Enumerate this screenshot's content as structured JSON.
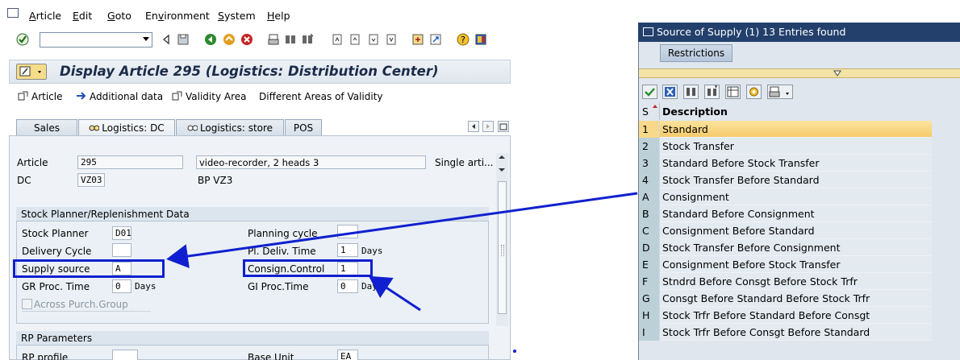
{
  "menu": {
    "items": [
      "Article",
      "Edit",
      "Goto",
      "Environment",
      "System",
      "Help"
    ],
    "underline": [
      "A",
      "E",
      "G",
      "v",
      "S",
      "H"
    ]
  },
  "title": "Display Article 295 (Logistics: Distribution Center)",
  "app_toolbar": {
    "article": "Article",
    "additional_data": "Additional data",
    "validity_area": "Validity Area",
    "different_areas": "Different Areas of Validity"
  },
  "tabs": [
    "Sales",
    "Logistics: DC",
    "Logistics: store",
    "POS"
  ],
  "header_fields": {
    "article_label": "Article",
    "article_value": "295",
    "article_desc": "video-recorder, 2 heads 3",
    "article_type": "Single arti...",
    "dc_label": "DC",
    "dc_value": "VZ03",
    "dc_desc": "BP VZ3"
  },
  "replenishment": {
    "title": "Stock Planner/Replenishment Data",
    "stock_planner_label": "Stock Planner",
    "stock_planner_value": "D01",
    "delivery_cycle_label": "Delivery Cycle",
    "delivery_cycle_value": "",
    "supply_source_label": "Supply source",
    "supply_source_value": "A",
    "gr_proc_time_label": "GR Proc. Time",
    "gr_proc_time_value": "0",
    "gr_proc_time_unit": "Days",
    "across_purch_group_label": "Across Purch.Group",
    "planning_cycle_label": "Planning cycle",
    "planning_cycle_value": "",
    "pl_deliv_time_label": "Pl. Deliv. Time",
    "pl_deliv_time_value": "1",
    "pl_deliv_time_unit": "Days",
    "consign_control_label": "Consign.Control",
    "consign_control_value": "1",
    "gi_proc_time_label": "GI Proc.Time",
    "gi_proc_time_value": "0",
    "gi_proc_time_unit": "Days"
  },
  "rp_parameters": {
    "title": "RP Parameters",
    "rp_profile_label": "RP profile",
    "rp_profile_value": "",
    "base_unit_label": "Base Unit",
    "base_unit_value": "EA"
  },
  "popup": {
    "title": "Source of Supply (1)   13 Entries found",
    "tab": "Restrictions",
    "col_s": "S",
    "col_desc": "Description",
    "rows": [
      {
        "key": "1",
        "desc": "Standard"
      },
      {
        "key": "2",
        "desc": "Stock Transfer"
      },
      {
        "key": "3",
        "desc": "Standard Before Stock Transfer"
      },
      {
        "key": "4",
        "desc": "Stock Transfer Before Standard"
      },
      {
        "key": "A",
        "desc": "Consignment"
      },
      {
        "key": "B",
        "desc": "Standard Before Consignment"
      },
      {
        "key": "C",
        "desc": "Consignment Before Standard"
      },
      {
        "key": "D",
        "desc": "Stock Transfer Before Consignment"
      },
      {
        "key": "E",
        "desc": "Consignment Before Stock Transfer"
      },
      {
        "key": "F",
        "desc": "Stndrd Before Consgt Before Stock Trfr"
      },
      {
        "key": "G",
        "desc": "Consgt Before Standard Before Stock Trfr"
      },
      {
        "key": "H",
        "desc": "Stock Trfr Before Standard Before Consgt"
      },
      {
        "key": "I",
        "desc": "Stock Trfr Before Consgt Before Standard"
      }
    ],
    "selected_index": 0
  },
  "colors": {
    "annotation": "#1020d0",
    "popup_title_bg": "#23406c",
    "selected_row": "#f8d88a"
  }
}
